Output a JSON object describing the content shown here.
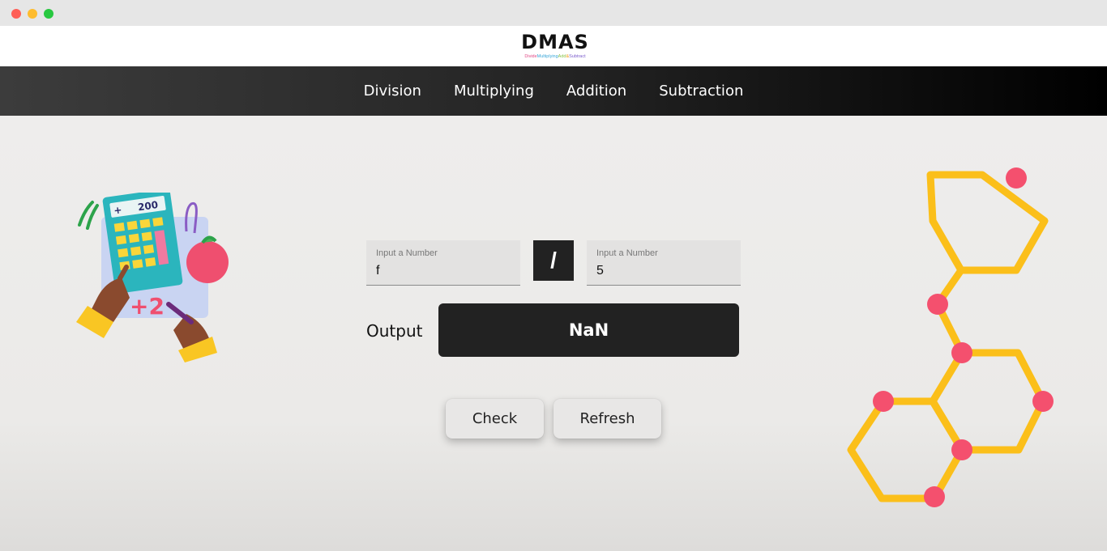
{
  "app": {
    "logo_title": "DMAS",
    "logo_tagline": [
      "Divide",
      "Multiplying",
      "Add",
      "&",
      "Subtract"
    ]
  },
  "nav": {
    "items": [
      "Division",
      "Multiplying",
      "Addition",
      "Subtraction"
    ]
  },
  "calculator": {
    "first_input": {
      "label": "Input a Number",
      "value": "f"
    },
    "operator": "/",
    "second_input": {
      "label": "Input a Number",
      "value": "5"
    },
    "output_label": "Output",
    "output_value": "NaN"
  },
  "buttons": {
    "check": "Check",
    "refresh": "Refresh"
  },
  "illustrations": {
    "left": {
      "icon": "calculator-illustration-icon",
      "display_text": "200"
    },
    "right": {
      "icon": "hexagon-molecule-icon"
    }
  },
  "colors": {
    "nav_dark": "#000000",
    "output_bg": "#222222",
    "hex_yellow": "#fbbf1a",
    "node_pink": "#f4506e"
  }
}
